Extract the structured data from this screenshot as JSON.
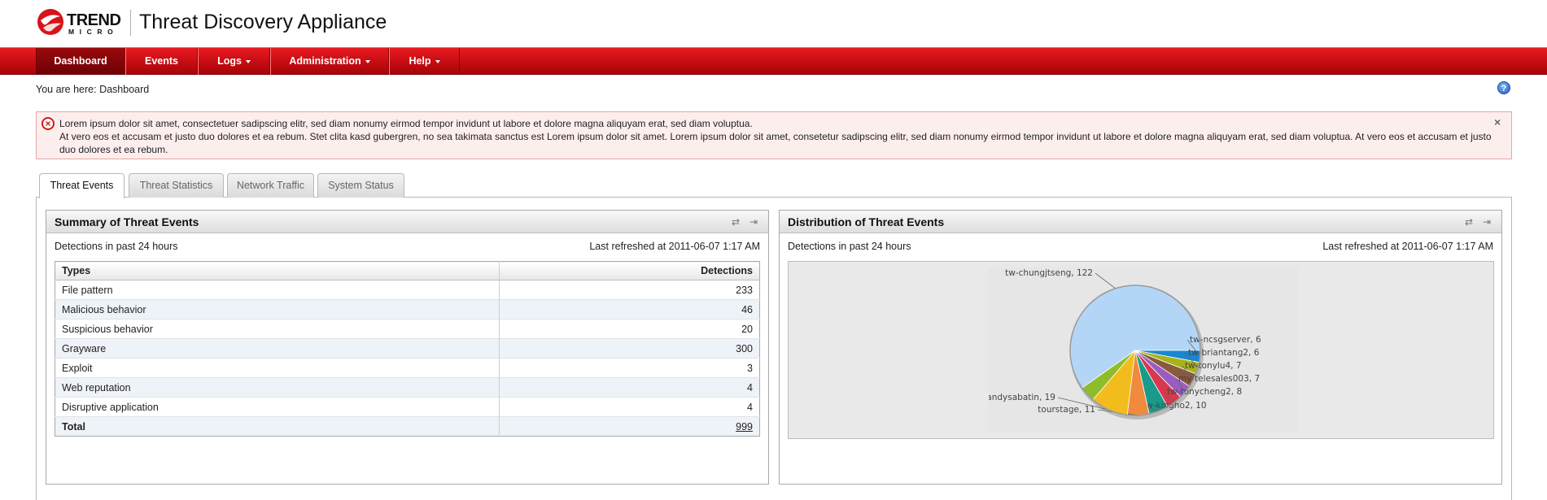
{
  "header": {
    "logo_trend": "TREND",
    "logo_micro": "MICRO",
    "app_title": "Threat Discovery Appliance"
  },
  "nav": {
    "items": [
      {
        "label": "Dashboard",
        "active": true,
        "dropdown": false
      },
      {
        "label": "Events",
        "active": false,
        "dropdown": false
      },
      {
        "label": "Logs",
        "active": false,
        "dropdown": true
      },
      {
        "label": "Administration",
        "active": false,
        "dropdown": true
      },
      {
        "label": "Help",
        "active": false,
        "dropdown": true
      }
    ]
  },
  "breadcrumb": "You are here: Dashboard",
  "alert": {
    "line1": "Lorem ipsum dolor sit amet, consectetuer sadipscing elitr, sed diam nonumy eirmod tempor invidunt ut labore et dolore magna aliquyam erat, sed diam voluptua.",
    "line2": "At vero eos et accusam et justo duo dolores et ea rebum. Stet clita kasd gubergren, no sea takimata sanctus est Lorem ipsum dolor sit amet. Lorem ipsum dolor sit amet, consetetur sadipscing elitr, sed diam nonumy eirmod tempor invidunt ut labore et dolore magna aliquyam erat, sed diam voluptua. At vero eos et accusam et justo duo dolores et ea rebum."
  },
  "tabs": [
    {
      "label": "Threat Events",
      "active": true
    },
    {
      "label": "Threat Statistics",
      "active": false
    },
    {
      "label": "Network Traffic",
      "active": false
    },
    {
      "label": "System Status",
      "active": false
    }
  ],
  "summary_panel": {
    "title": "Summary of Threat Events",
    "subtitle": "Detections in past 24 hours",
    "refreshed": "Last refreshed at 2011-06-07 1:17 AM",
    "columns": [
      "Types",
      "Detections"
    ],
    "rows": [
      {
        "type": "File pattern",
        "count": "233"
      },
      {
        "type": "Malicious behavior",
        "count": "46"
      },
      {
        "type": "Suspicious behavior",
        "count": "20"
      },
      {
        "type": "Grayware",
        "count": "300"
      },
      {
        "type": "Exploit",
        "count": "3"
      },
      {
        "type": "Web reputation",
        "count": "4"
      },
      {
        "type": "Disruptive application",
        "count": "4"
      }
    ],
    "total_label": "Total",
    "total_value": "999"
  },
  "distribution_panel": {
    "title": "Distribution of Threat Events",
    "subtitle": "Detections in past 24 hours",
    "refreshed": "Last refreshed at 2011-06-07 1:17 AM"
  },
  "chart_data": {
    "type": "pie",
    "slices": [
      {
        "label": "tw-chungjtseng",
        "value": 122,
        "color": "#b3d6f7"
      },
      {
        "label": "tw-ncsgserver",
        "value": 6,
        "color": "#1a86d0"
      },
      {
        "label": "tw-briantang2",
        "value": 6,
        "color": "#a8b31a"
      },
      {
        "label": "tw-tonylu4",
        "value": 7,
        "color": "#8a5a3c"
      },
      {
        "label": "my-telesales003",
        "value": 7,
        "color": "#9b5cc2"
      },
      {
        "label": "tw-tonycheng2",
        "value": 8,
        "color": "#d8384d"
      },
      {
        "label": "tw-kingho2",
        "value": 10,
        "color": "#1a9a8a"
      },
      {
        "label": "tourstage",
        "value": 11,
        "color": "#f08a3c"
      },
      {
        "label": "tw-randysabatin",
        "value": 19,
        "color": "#f2bd1c"
      },
      {
        "label": "",
        "value": 8,
        "color": "#8fbd2a"
      }
    ]
  },
  "colors": {
    "nav_red": "#c50c12",
    "alert_bg": "#fdeeee",
    "alert_border": "#e6a7a7",
    "row_alt": "#eef3f9"
  }
}
